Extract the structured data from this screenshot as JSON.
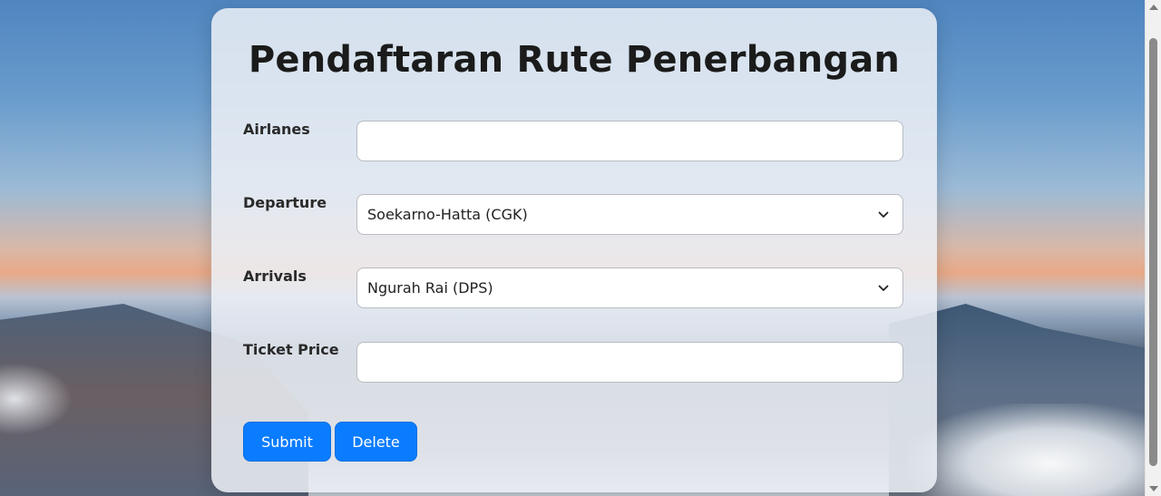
{
  "form": {
    "title": "Pendaftaran Rute Penerbangan",
    "fields": [
      {
        "label": "Airlanes",
        "type": "text",
        "value": ""
      },
      {
        "label": "Departure",
        "type": "select",
        "value": "Soekarno-Hatta (CGK)"
      },
      {
        "label": "Arrivals",
        "type": "select",
        "value": "Ngurah Rai (DPS)"
      },
      {
        "label": "Ticket Price",
        "type": "text",
        "value": ""
      }
    ],
    "buttons": {
      "submit_label": "Submit",
      "delete_label": "Delete"
    }
  },
  "icons": {
    "select_arrow": "chevron-down-icon",
    "scroll_up": "scroll-up-arrow-icon",
    "scroll_down": "scroll-down-arrow-icon"
  },
  "colors": {
    "primary_button": "#0a7cff",
    "card_background": "#ecf0f6",
    "title_text": "#1b1b1b"
  }
}
